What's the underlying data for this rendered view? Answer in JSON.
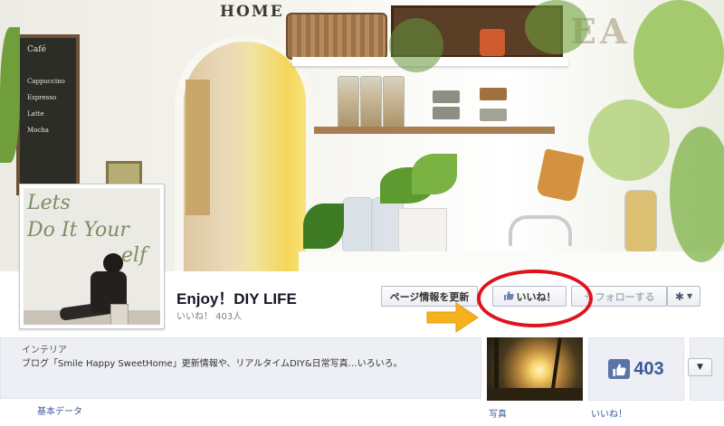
{
  "cover": {
    "sign_text": "HOME",
    "wall_letters": "EA",
    "chalk_lines": [
      "Café",
      "Cappuccino",
      "Espresso",
      "Latte",
      "Mocha"
    ]
  },
  "profile": {
    "scribble_line1": "Lets",
    "scribble_line2": "Do It Your",
    "scribble_line3": "elf"
  },
  "header": {
    "page_name": "Enjoy！DIY LIFE",
    "like_count": "いいね！ 403人"
  },
  "buttons": {
    "update_info": "ページ情報を更新",
    "like": "いいね！",
    "like_icon": "thumbs-up-icon",
    "follow": "フォローする",
    "follow_prefix": "+",
    "settings_icon": "gear-icon",
    "caret": "▼"
  },
  "about": {
    "category": "インテリア",
    "description": "ブログ「Smile Happy SweetHome」更新情報や、リアルタイムDIY&日常写真…いろいろ。",
    "basic_data_link": "基本データ"
  },
  "photos": {
    "label": "写真"
  },
  "likes": {
    "count": "403",
    "label": "いいね！",
    "thumb_glyph": "👍"
  },
  "annotation": {
    "highlight_color": "#e0131d",
    "arrow_color": "#f5b21e"
  },
  "expand": {
    "caret": "▼"
  }
}
